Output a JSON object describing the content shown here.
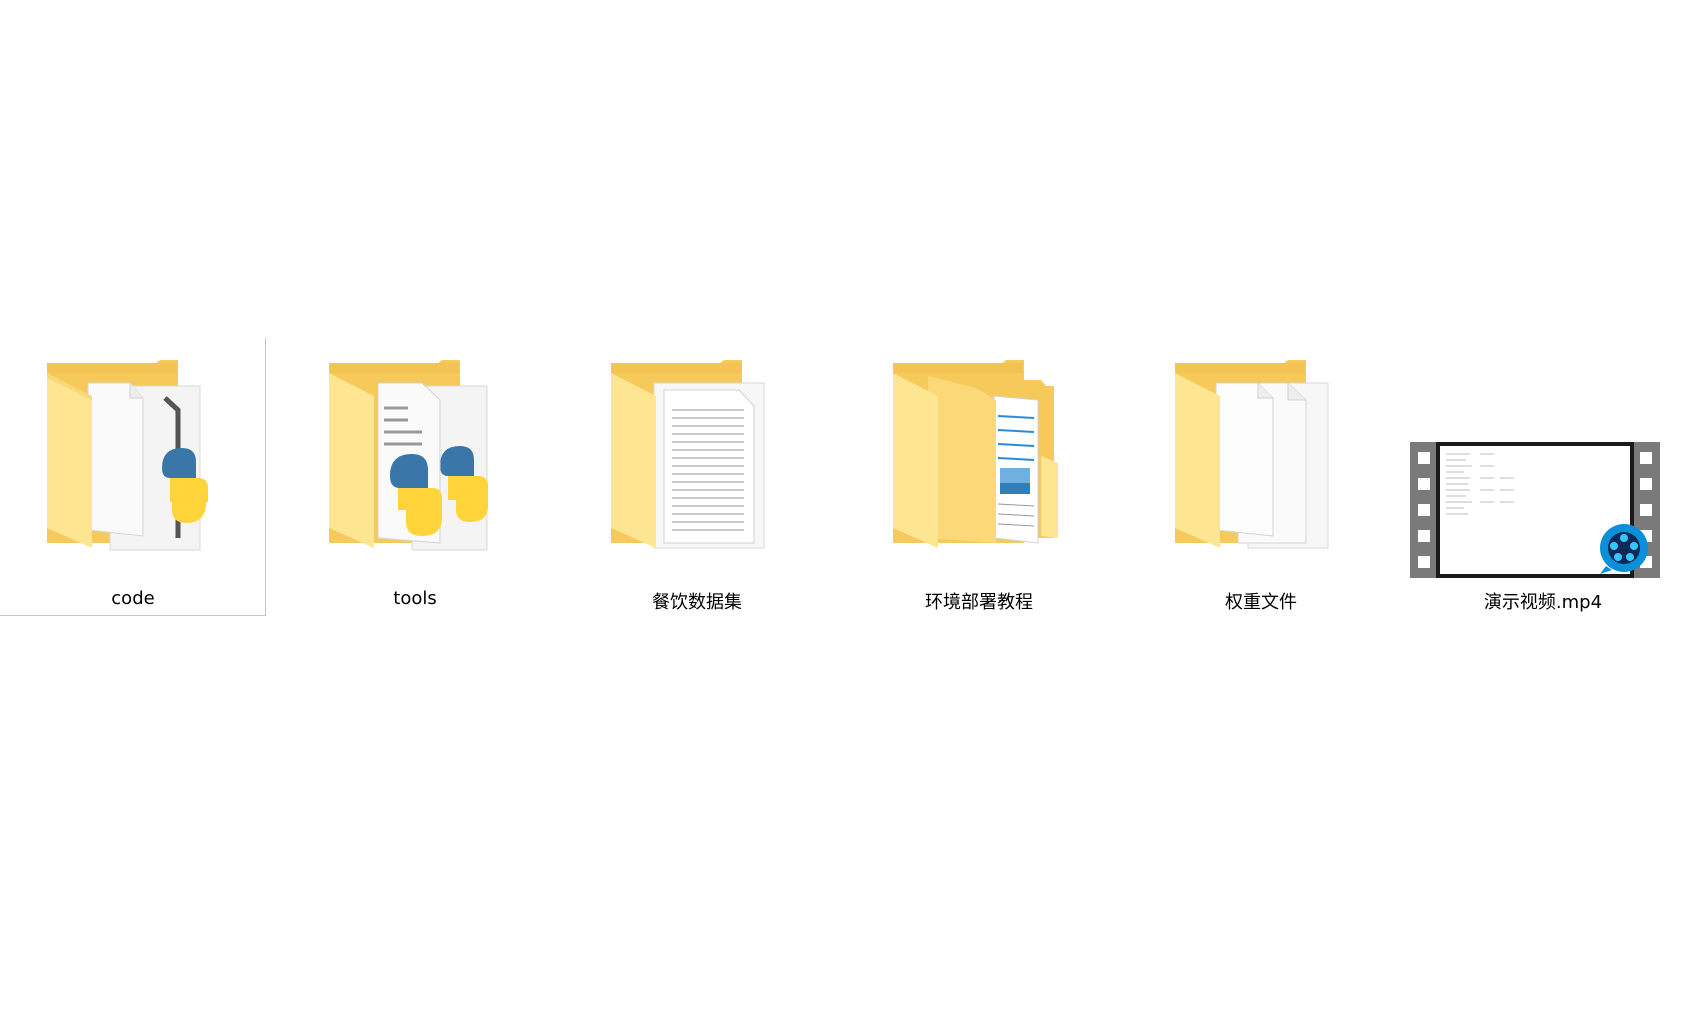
{
  "items": [
    {
      "label": "code",
      "icon": "folder-python-icon",
      "selected": true
    },
    {
      "label": "tools",
      "icon": "folder-python-icon",
      "selected": false
    },
    {
      "label": "餐饮数据集",
      "icon": "folder-document-icon",
      "selected": false
    },
    {
      "label": "环境部署教程",
      "icon": "folder-tutorial-icon",
      "selected": false
    },
    {
      "label": "权重文件",
      "icon": "folder-files-icon",
      "selected": false
    },
    {
      "label": "演示视频.mp4",
      "icon": "video-file-icon",
      "selected": false
    }
  ],
  "colors": {
    "folder_back": "#f5c95a",
    "folder_front": "#fde591",
    "selection_border": "#99d1ff",
    "python_blue": "#3b76a8",
    "python_yellow": "#ffd43b",
    "video_badge": "#0a8fd8"
  }
}
